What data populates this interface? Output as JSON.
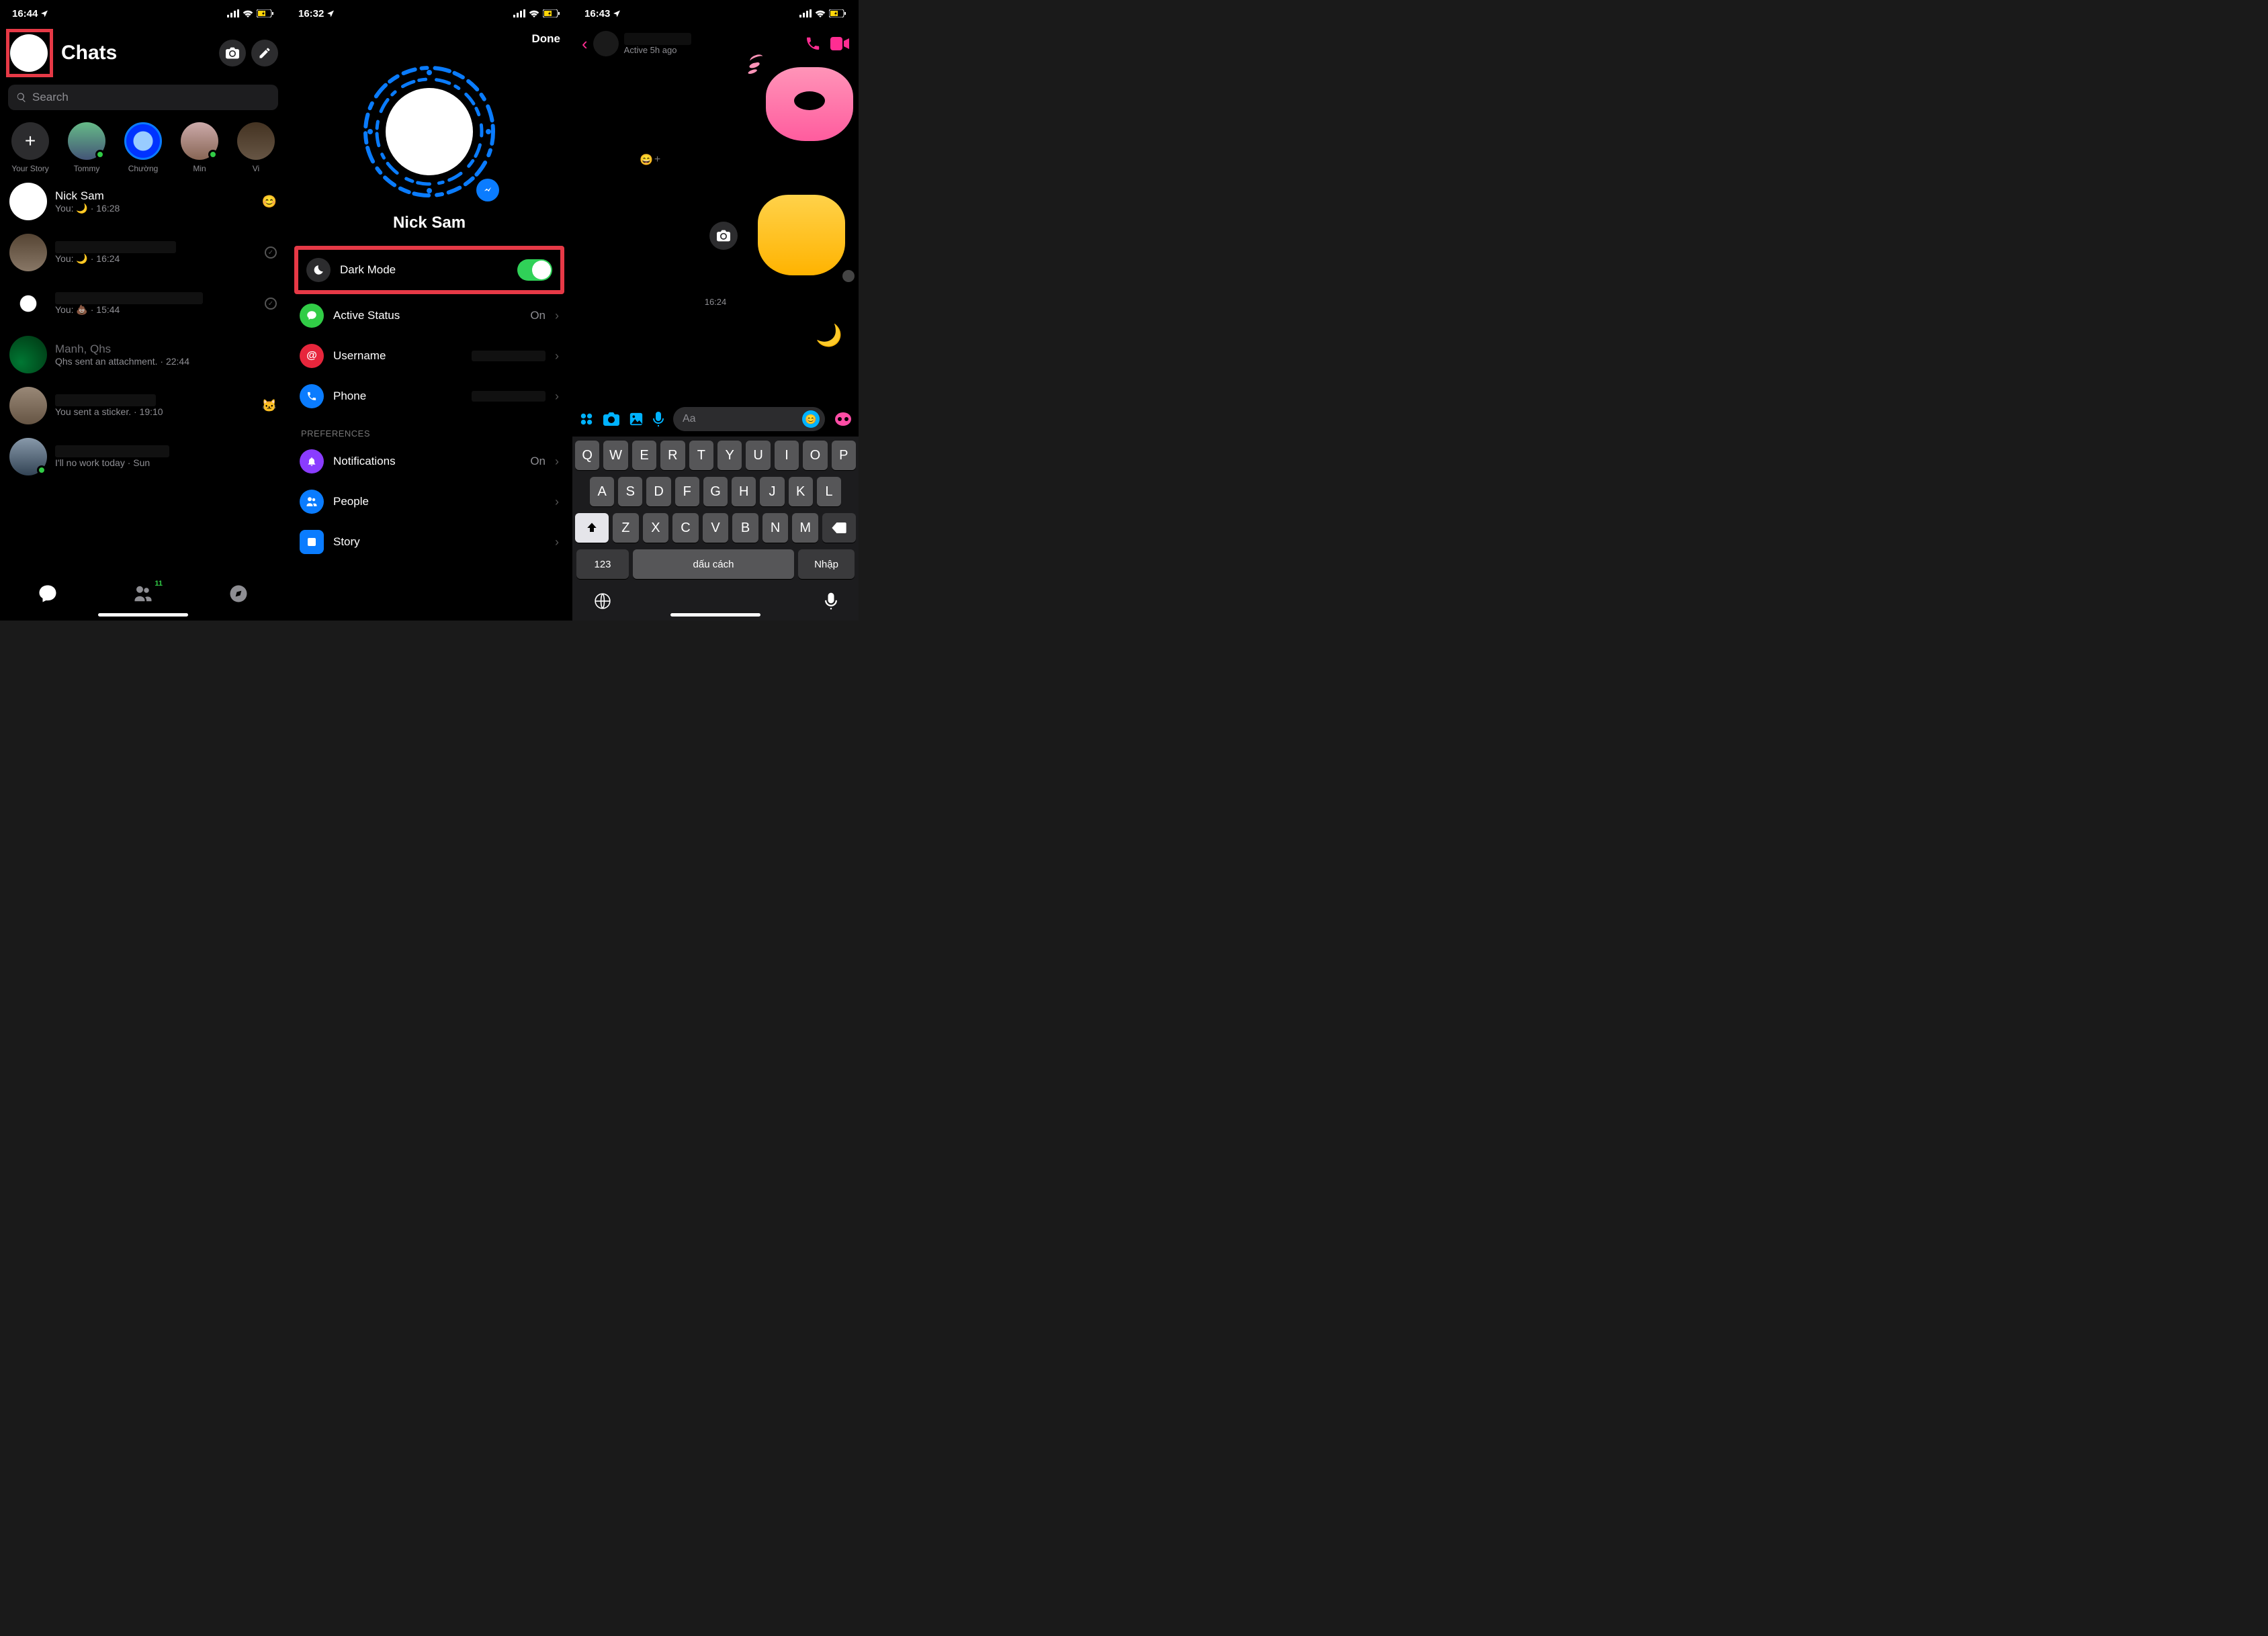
{
  "screen1": {
    "status": {
      "time": "16:44",
      "loc_icon": "location-arrow"
    },
    "title": "Chats",
    "search_placeholder": "Search",
    "stories": [
      {
        "label": "Your Story",
        "type": "add"
      },
      {
        "label": "Tommy",
        "online": true
      },
      {
        "label": "Chường",
        "ring": true
      },
      {
        "label": "Min",
        "online": true
      },
      {
        "label": "Vi"
      }
    ],
    "chats": [
      {
        "name": "Nick Sam",
        "preview": "You: 🌙 · 16:28",
        "badge": "😊",
        "avatar": "white"
      },
      {
        "name": "",
        "preview": "You: 🌙 · 16:24",
        "check": true,
        "dim": true
      },
      {
        "name": "",
        "preview": "You: 💩 · 15:44",
        "check": true,
        "dim": true
      },
      {
        "name": "Manh, Qhs",
        "preview": "Qhs sent an attachment. · 22:44",
        "dim": true
      },
      {
        "name": "",
        "preview": "You sent a sticker. · 19:10",
        "badge": "🐱",
        "dim": true
      },
      {
        "name": "",
        "preview": "I'll no work today · Sun",
        "online": true,
        "dim": true
      }
    ],
    "tabs": {
      "discover_badge": "11"
    }
  },
  "screen2": {
    "status": {
      "time": "16:32"
    },
    "done": "Done",
    "profile_name": "Nick Sam",
    "settings": [
      {
        "icon_bg": "#2c2c2e",
        "icon": "moon",
        "label": "Dark Mode",
        "toggle": true,
        "highlight": true
      },
      {
        "icon_bg": "#31cc46",
        "icon": "chat",
        "label": "Active Status",
        "value": "On"
      },
      {
        "icon_bg": "#e7263c",
        "icon": "at",
        "label": "Username",
        "value": ""
      },
      {
        "icon_bg": "#0a7cff",
        "icon": "phone",
        "label": "Phone",
        "value": ""
      }
    ],
    "section": "PREFERENCES",
    "prefs": [
      {
        "icon_bg": "#8a3cff",
        "icon": "bell",
        "label": "Notifications",
        "value": "On"
      },
      {
        "icon_bg": "#0a7cff",
        "icon": "people",
        "label": "People",
        "value": ""
      },
      {
        "icon_bg": "#0a7cff",
        "icon": "story",
        "label": "Story",
        "value": ""
      }
    ]
  },
  "screen3": {
    "status": {
      "time": "16:43"
    },
    "contact": {
      "status": "Active 5h ago"
    },
    "thread_time": "16:24",
    "composer_placeholder": "Aa",
    "keyboard": {
      "rows": [
        [
          "Q",
          "W",
          "E",
          "R",
          "T",
          "Y",
          "U",
          "I",
          "O",
          "P"
        ],
        [
          "A",
          "S",
          "D",
          "F",
          "G",
          "H",
          "J",
          "K",
          "L"
        ],
        [
          "Z",
          "X",
          "C",
          "V",
          "B",
          "N",
          "M"
        ]
      ],
      "num": "123",
      "space": "dấu cách",
      "enter": "Nhập"
    }
  }
}
